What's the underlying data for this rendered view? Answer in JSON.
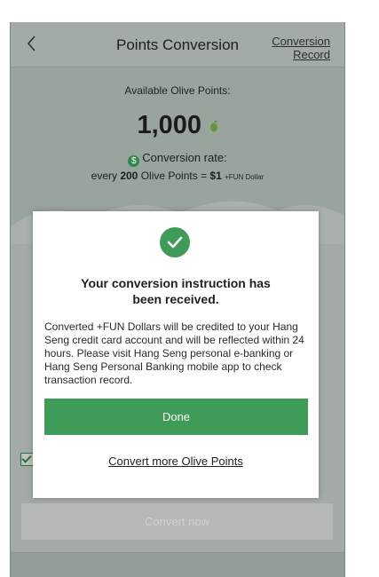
{
  "header": {
    "back_icon": "chevron-left-icon",
    "title": "Points Conversion",
    "record_link_line1": "Conversion",
    "record_link_line2": "Record"
  },
  "summary": {
    "available_label": "Available Olive Points:",
    "points_value": "1,000",
    "points_icon": "olive-icon",
    "rate_label": "Conversion rate:",
    "rate_prefix": "every",
    "rate_points": "200",
    "rate_mid": "Olive Points =",
    "rate_dollar": "$1",
    "rate_unit": "+FUN Dollar"
  },
  "form": {
    "convert_button": "Convert now"
  },
  "modal": {
    "icon": "check-circle-icon",
    "title_line1": "Your conversion instruction has",
    "title_line2": "been received.",
    "body": "Converted +FUN Dollars will be credited to your Hang Seng credit card account and will be reflected within 24 hours. Please visit Hang Seng personal e-banking or Hang Seng Personal Banking mobile app to check transaction record.",
    "done_button": "Done",
    "more_link": "Convert more Olive Points"
  },
  "colors": {
    "accent_green": "#3f9b58",
    "overlay_bg": "#9aa49f",
    "modal_bg": "#ffffff"
  }
}
